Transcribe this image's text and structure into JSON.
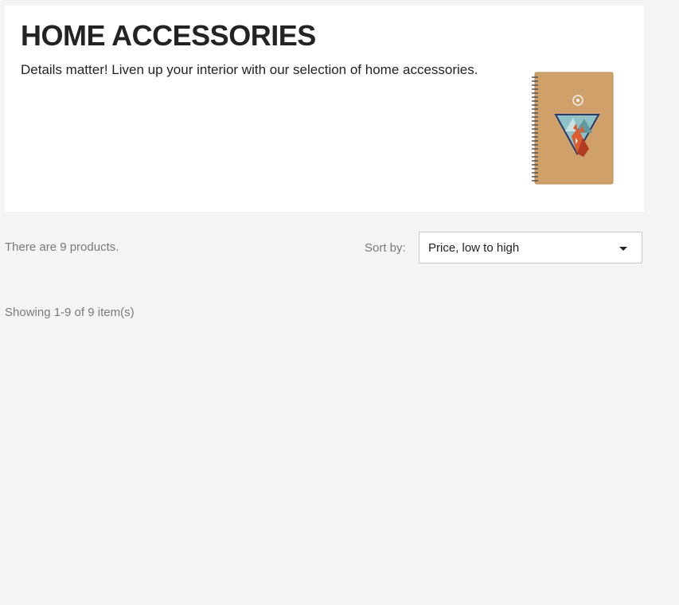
{
  "category": {
    "title": "HOME ACCESSORIES",
    "description": "Details matter! Liven up your interior with our selection of home accessories."
  },
  "listing": {
    "products_count": "There are 9 products.",
    "sort_label": "Sort by:",
    "sort_value": "Price, low to high",
    "showing": "Showing 1-9 of 9 item(s)"
  },
  "colors": {
    "page_background": "#f4f4f4",
    "panel_background": "#ffffff",
    "text_primary": "#232323",
    "text_muted": "#7a7a7a"
  },
  "icons": {
    "sort_dropdown": "caret-down-icon"
  }
}
